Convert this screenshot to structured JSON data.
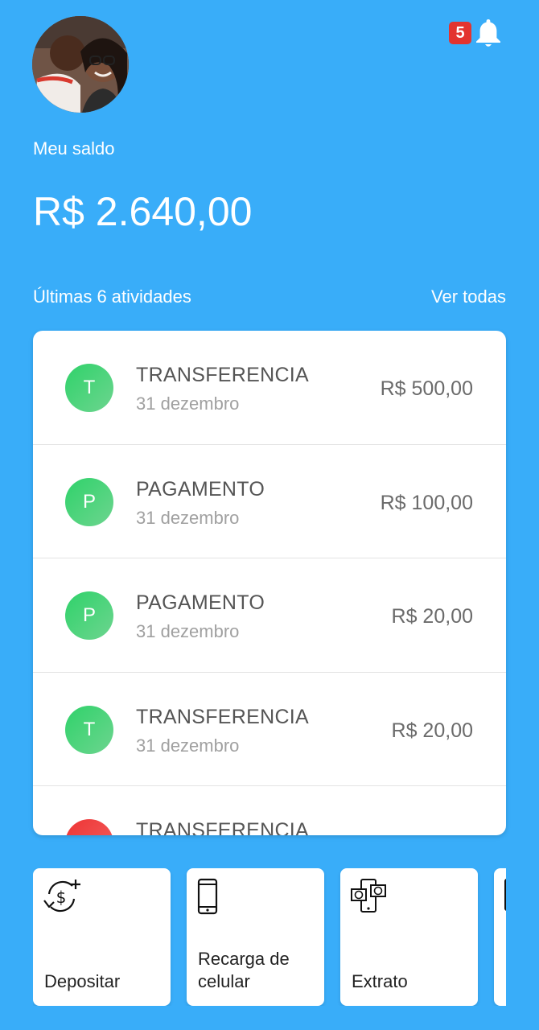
{
  "header": {
    "notification_count": "5",
    "avatar_icon": "user-photo",
    "bell_icon": "bell-icon"
  },
  "balance": {
    "label": "Meu saldo",
    "value": "R$ 2.640,00"
  },
  "activities": {
    "title": "Últimas 6 atividades",
    "see_all": "Ver todas",
    "items": [
      {
        "initial": "T",
        "title": "TRANSFERENCIA",
        "date": "31 dezembro",
        "amount": "R$ 500,00",
        "color": "#2fd26a"
      },
      {
        "initial": "P",
        "title": "PAGAMENTO",
        "date": "31 dezembro",
        "amount": "R$ 100,00",
        "color": "#2fd26a"
      },
      {
        "initial": "P",
        "title": "PAGAMENTO",
        "date": "31 dezembro",
        "amount": "R$ 20,00",
        "color": "#2fd26a"
      },
      {
        "initial": "T",
        "title": "TRANSFERENCIA",
        "date": "31 dezembro",
        "amount": "R$ 20,00",
        "color": "#2fd26a"
      },
      {
        "initial": "",
        "title": "TRANSFERENCIA",
        "date": "",
        "amount": "",
        "color": "#ee3434"
      }
    ]
  },
  "actions": [
    {
      "label": "Depositar",
      "icon": "deposit-icon"
    },
    {
      "label": "Recarga de\ncelular",
      "icon": "phone-icon"
    },
    {
      "label": "Extrato",
      "icon": "statement-icon"
    },
    {
      "label": "",
      "icon": "document-icon"
    }
  ],
  "colors": {
    "background": "#39adf9",
    "card": "#ffffff",
    "badge": "#e3342f",
    "positive": "#2fd26a",
    "negative": "#ee3434"
  }
}
